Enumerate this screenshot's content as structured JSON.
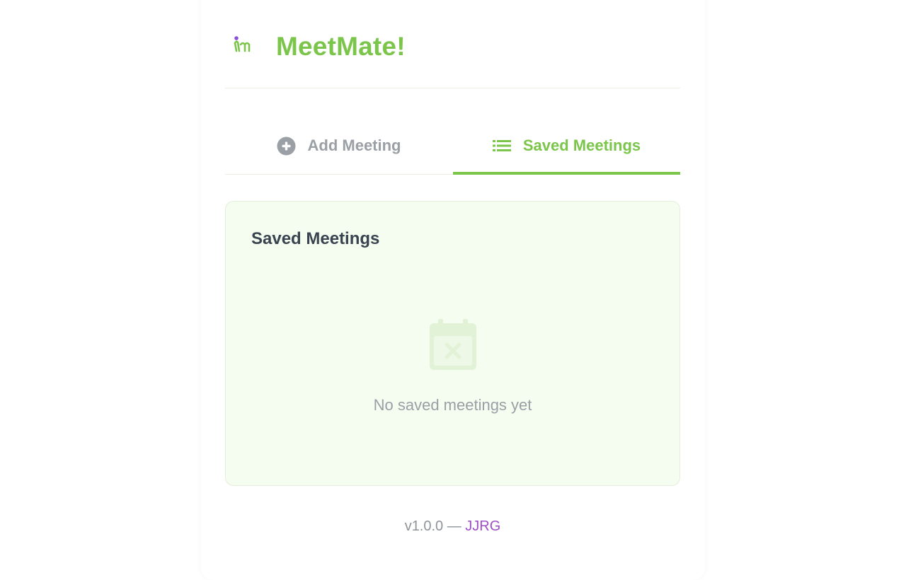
{
  "app": {
    "title": "MeetMate!",
    "logo_icon": "meetmate-logo-icon",
    "brand_color": "#7cc54b",
    "accent_color": "#8a4fd8"
  },
  "tabs": [
    {
      "label": "Add Meeting",
      "icon": "plus-circle-icon",
      "active": false
    },
    {
      "label": "Saved Meetings",
      "icon": "list-icon",
      "active": true
    }
  ],
  "saved_panel": {
    "title": "Saved Meetings",
    "empty_icon": "calendar-x-icon",
    "empty_message": "No saved meetings yet"
  },
  "footer": {
    "version": "v1.0.0",
    "separator": "—",
    "author": "JJRG",
    "author_color": "#9c4fc4"
  }
}
